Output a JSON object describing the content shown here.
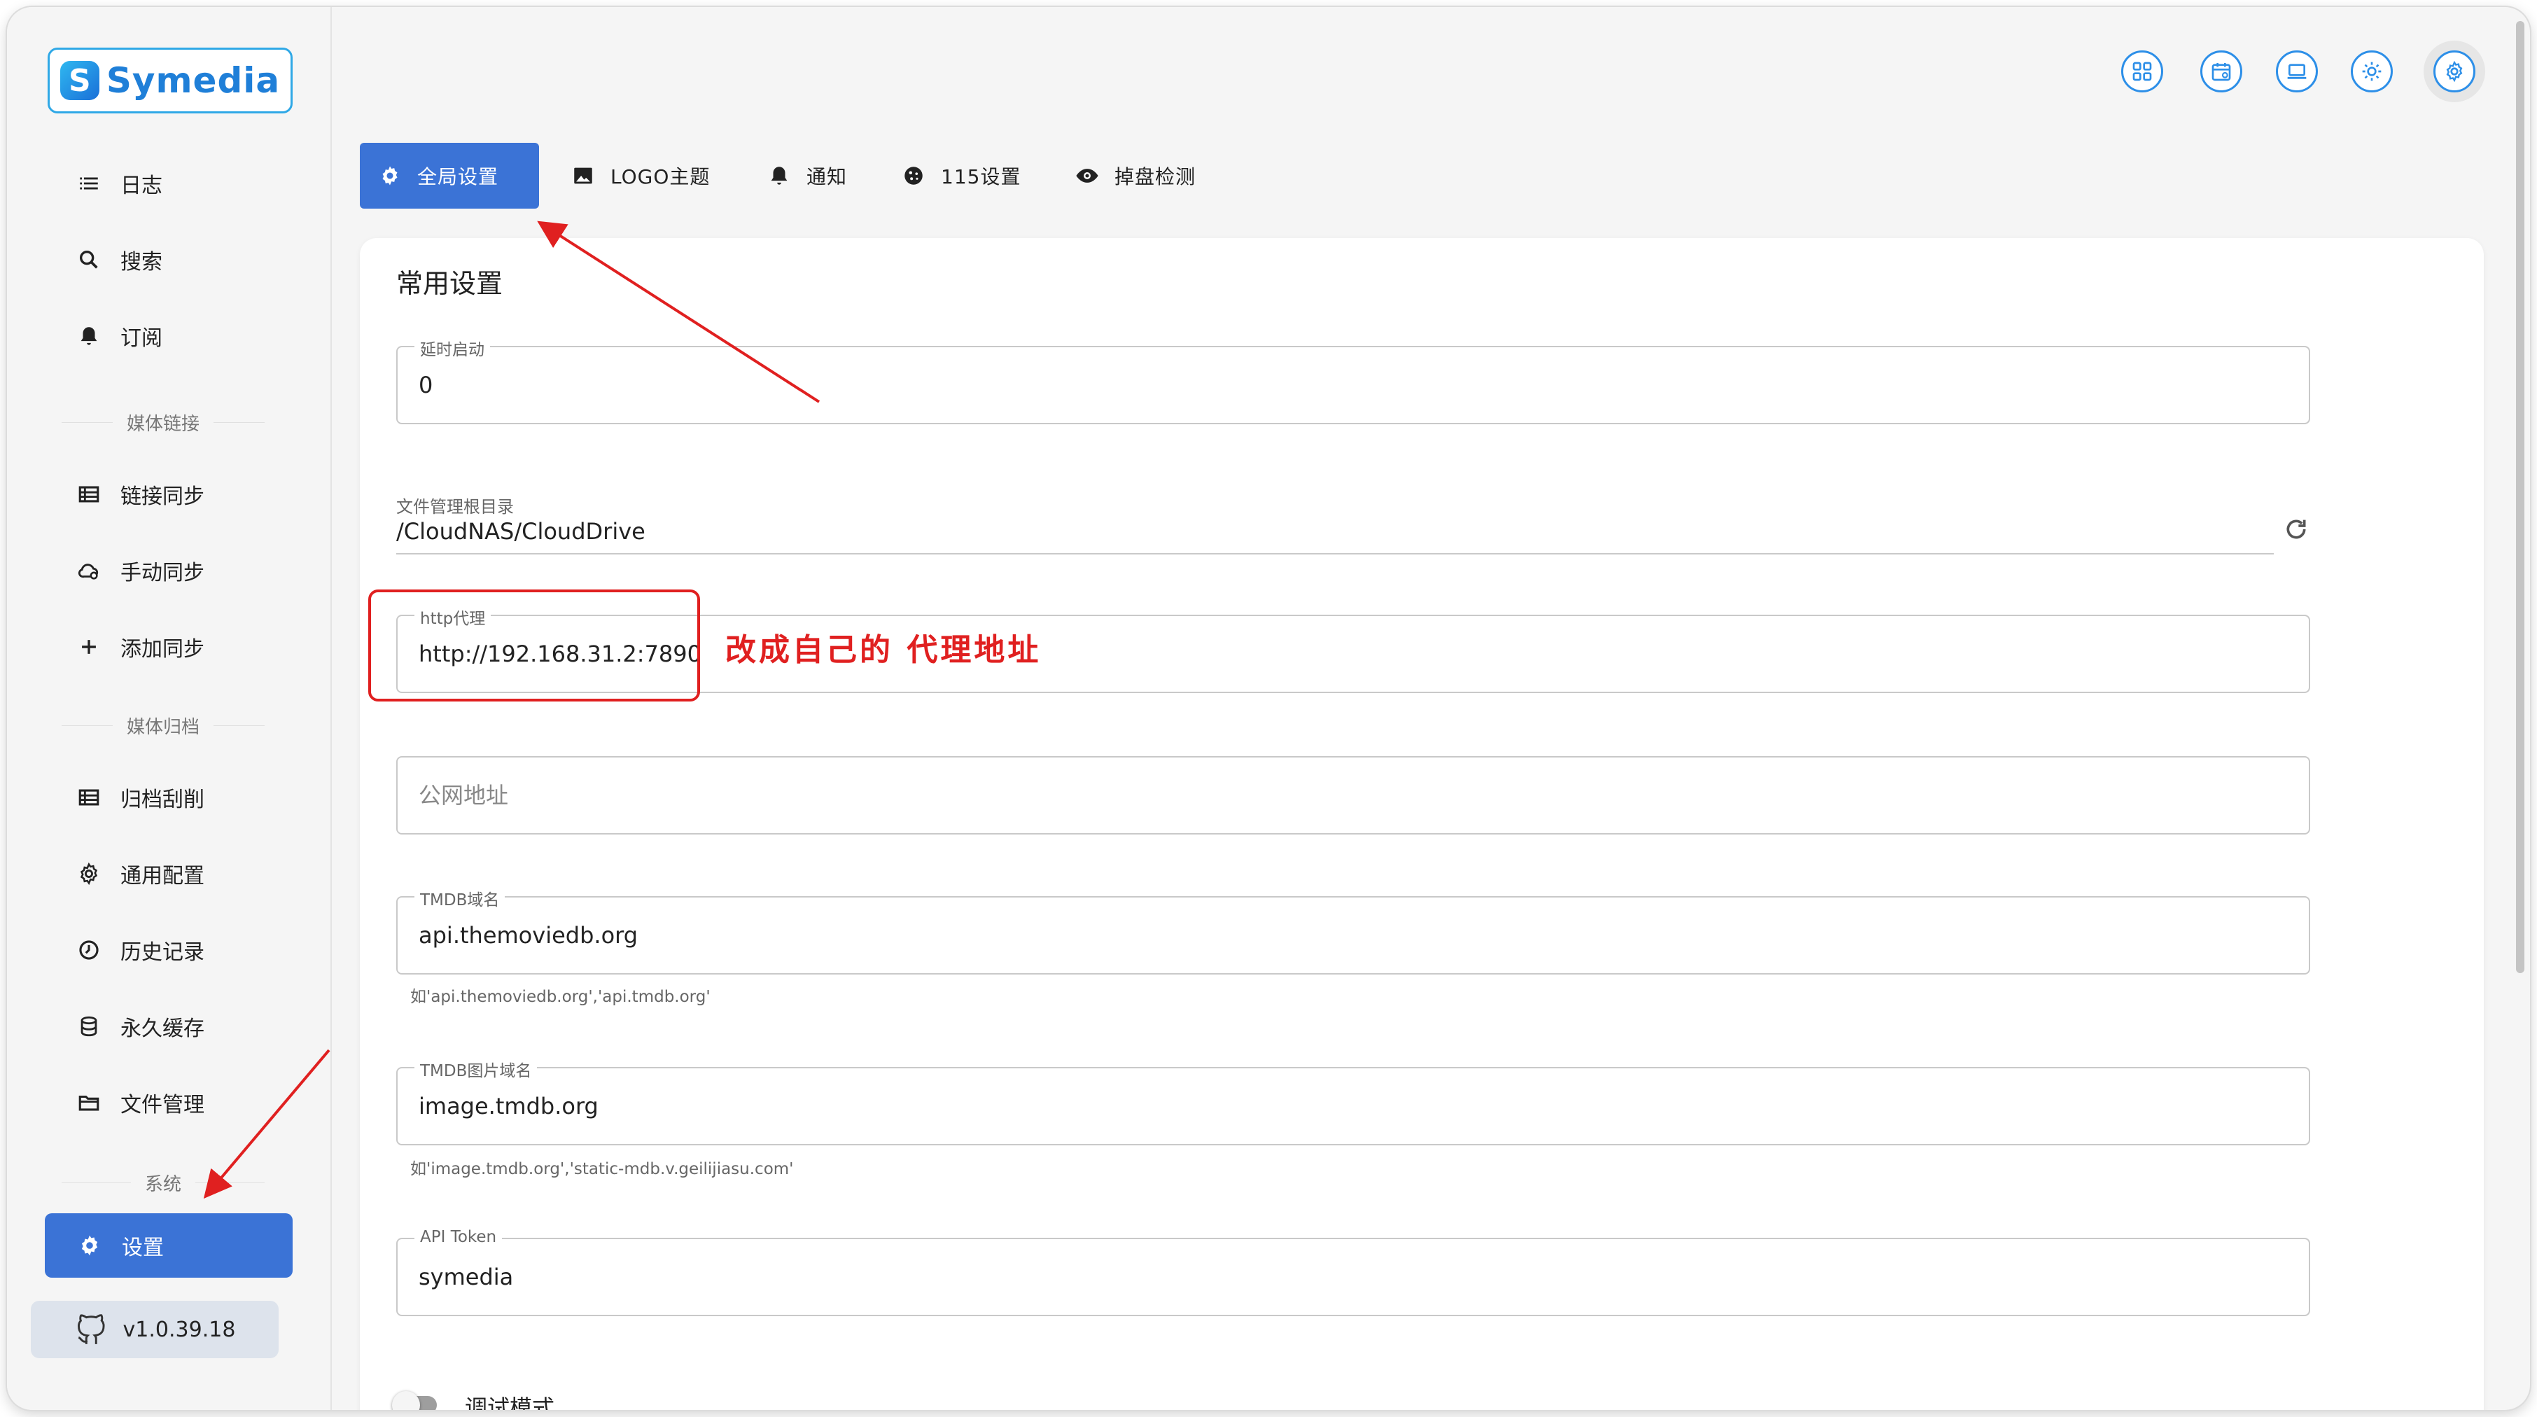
{
  "app": {
    "logo_text": "Symedia",
    "version": "v1.0.39.18"
  },
  "sidebar": {
    "items": [
      {
        "label": "日志",
        "icon": "list-icon"
      },
      {
        "label": "搜索",
        "icon": "search-icon"
      },
      {
        "label": "订阅",
        "icon": "bell-icon"
      }
    ],
    "section_media_link": "媒体链接",
    "media_link_items": [
      {
        "label": "链接同步",
        "icon": "table-icon"
      },
      {
        "label": "手动同步",
        "icon": "cloud-sync-icon"
      },
      {
        "label": "添加同步",
        "icon": "plus-icon"
      }
    ],
    "section_media_archive": "媒体归档",
    "archive_items": [
      {
        "label": "归档刮削",
        "icon": "table-icon"
      },
      {
        "label": "通用配置",
        "icon": "gear-icon"
      },
      {
        "label": "历史记录",
        "icon": "clock-icon"
      },
      {
        "label": "永久缓存",
        "icon": "database-icon"
      },
      {
        "label": "文件管理",
        "icon": "folder-icon"
      }
    ],
    "section_system": "系统",
    "active_item": {
      "label": "设置",
      "icon": "gear-icon"
    }
  },
  "tabs": [
    {
      "label": "全局设置",
      "icon": "gear-icon",
      "active": true
    },
    {
      "label": "LOGO主题",
      "icon": "image-icon",
      "active": false
    },
    {
      "label": "通知",
      "icon": "bell-icon",
      "active": false
    },
    {
      "label": "115设置",
      "icon": "cookie-icon",
      "active": false
    },
    {
      "label": "掉盘检测",
      "icon": "eye-icon",
      "active": false
    }
  ],
  "settings": {
    "title": "常用设置",
    "delay_start": {
      "label": "延时启动",
      "value": "0"
    },
    "file_root": {
      "label": "文件管理根目录",
      "value": "/CloudNAS/CloudDrive"
    },
    "http_proxy": {
      "label": "http代理",
      "value": "http://192.168.31.2:7890"
    },
    "public_address": {
      "placeholder": "公网地址"
    },
    "tmdb_domain": {
      "label": "TMDB域名",
      "value": "api.themoviedb.org",
      "hint": "如'api.themoviedb.org','api.tmdb.org'"
    },
    "tmdb_image_domain": {
      "label": "TMDB图片域名",
      "value": "image.tmdb.org",
      "hint": "如'image.tmdb.org','static-mdb.v.geilijiasu.com'"
    },
    "api_token": {
      "label": "API Token",
      "value": "symedia"
    },
    "debug_mode": {
      "label": "调试模式",
      "enabled": false
    }
  },
  "annotation": {
    "text": "改成自己的 代理地址",
    "color": "#e02020"
  },
  "colors": {
    "accent": "#3b73d6",
    "icon_blue": "#2d8fe8"
  }
}
